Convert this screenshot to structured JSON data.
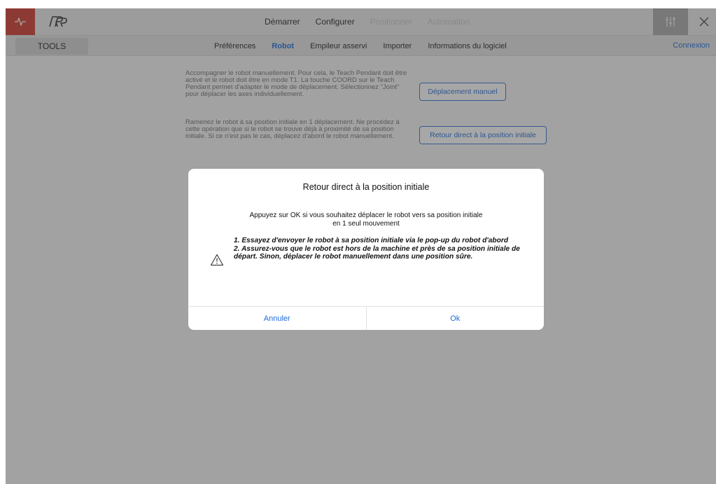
{
  "colors": {
    "accent": "#1e6ad8",
    "brand_red": "#d23a2f",
    "disabled_text": "#c6c6c6"
  },
  "topbar": {
    "logo_icon": "pulse-icon",
    "brand_icon": "robot-brand-logo",
    "tabs": [
      {
        "label": "Démarrer",
        "enabled": true
      },
      {
        "label": "Configurer",
        "enabled": true
      },
      {
        "label": "Positionner",
        "enabled": false
      },
      {
        "label": "Automation",
        "enabled": false
      }
    ],
    "settings_icon": "sliders-icon",
    "close_icon": "close-icon"
  },
  "subbar": {
    "tools_label": "TOOLS",
    "tabs": [
      {
        "label": "Préférences",
        "active": false
      },
      {
        "label": "Robot",
        "active": true
      },
      {
        "label": "Empileur asservi",
        "active": false
      },
      {
        "label": "Importer",
        "active": false
      },
      {
        "label": "Informations du logiciel",
        "active": false
      }
    ],
    "connexion_label": "Connexion"
  },
  "content": {
    "actions": [
      {
        "description": "Accompagner le robot manuellement. Pour cela, le Teach Pendant doit être activé et le robot doit être en mode T1. La touche COORD sur le Teach Pendant permet d'adapter le mode de déplacement. Sélectionnez \"Joint\" pour déplacer les axes individuellement.",
        "button_label": "Déplacement manuel"
      },
      {
        "description": "Ramenez le robot à sa position initiale en 1 déplacement. Ne procédez à cette opération que si le robot se trouve déjà à proximité de sa position initiale. Si ce n'est pas le cas, déplacez d'abord le robot manuellement.",
        "button_label": "Retour direct à la position initiale"
      }
    ]
  },
  "dialog": {
    "title": "Retour direct à la position initiale",
    "message": "Appuyez sur OK si vous souhaitez déplacer le robot vers sa position initiale en 1 seul mouvement",
    "warning_icon": "warning-triangle-icon",
    "warnings": [
      "1. Essayez d'envoyer le robot à sa position initiale via le pop-up du robot d'abord",
      "2. Assurez-vous que le robot est hors de la machine et près de sa position initiale de départ. Sinon, déplacer le robot manuellement dans une position sûre."
    ],
    "cancel_label": "Annuler",
    "ok_label": "Ok"
  }
}
